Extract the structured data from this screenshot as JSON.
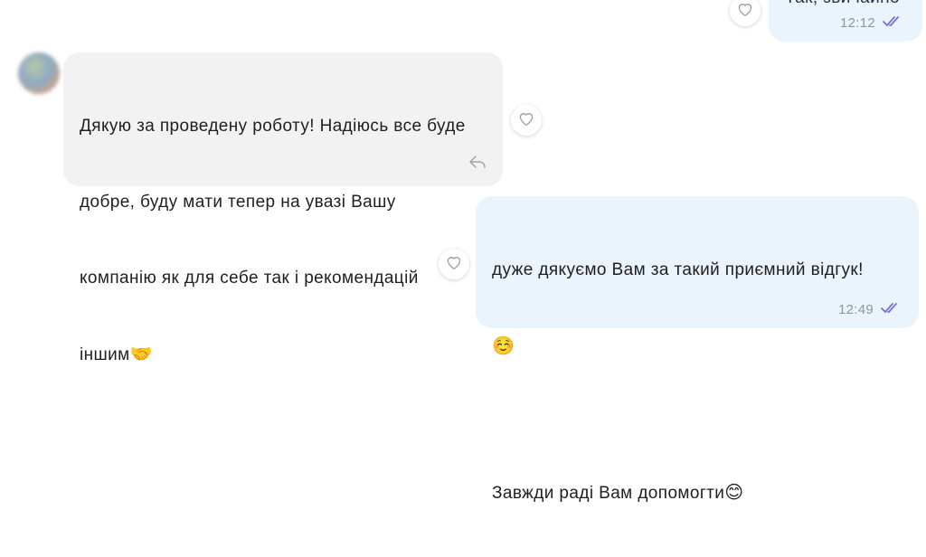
{
  "chat": {
    "top_message": {
      "text": "Так, звичайно",
      "time": "12:12"
    },
    "incoming_message": {
      "lines": [
        "Дякую за проведену роботу! Надіюсь все буде",
        "добре, буду мати тепер на увазі Вашу",
        "компанію як для себе так і рекомендацій",
        "іншим"
      ],
      "emoji": "🤝"
    },
    "reply_message": {
      "line1": "дуже дякуємо Вам за такий приємний відгук!",
      "emoji1": "☺️",
      "line2": "Завжди раді Вам допомогти",
      "emoji2": "😊",
      "time": "12:49"
    }
  },
  "icons": {
    "like": "heart-outline-icon",
    "reply": "reply-arrow-icon",
    "read": "double-check-icon"
  },
  "colors": {
    "incoming_bubble": "#f2f2f2",
    "outgoing_bubble": "#e9f4fd",
    "read_check": "#7b6fd6",
    "meta_text": "#8a96a3"
  }
}
